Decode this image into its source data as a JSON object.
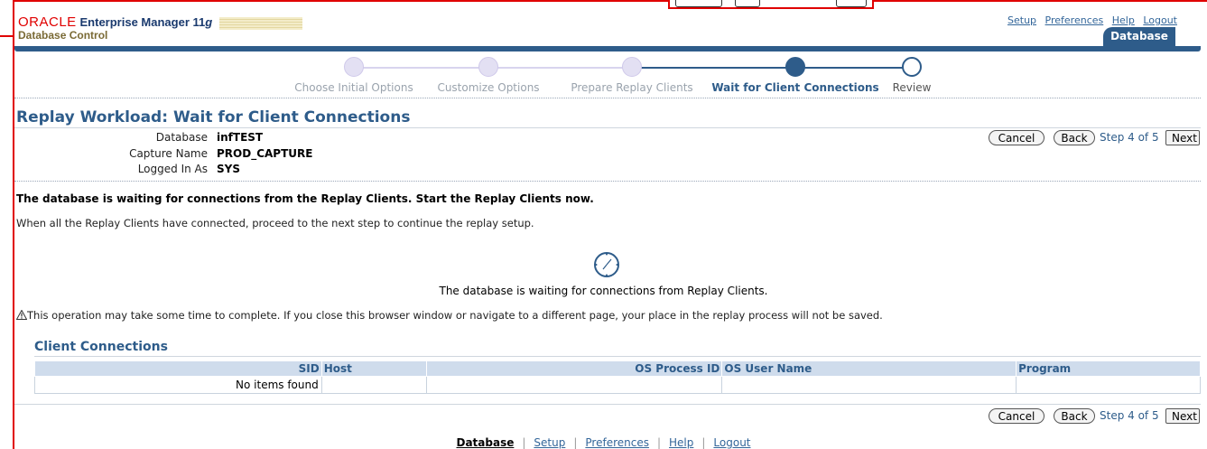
{
  "header": {
    "oracle": "ORACLE",
    "product": "Enterprise Manager 11",
    "version_suffix": "g",
    "subtitle": "Database Control",
    "links": [
      "Setup",
      "Preferences",
      "Help",
      "Logout"
    ],
    "tab": "Database"
  },
  "train": {
    "steps": [
      "Choose Initial Options",
      "Customize Options",
      "Prepare Replay Clients",
      "Wait for Client Connections",
      "Review"
    ],
    "current_step_index": 3,
    "colors": {
      "done": "#e3e0f3",
      "current": "#2e5c8a",
      "future": "#ffffff",
      "line_done": "#d8d4ee",
      "line_current": "#2e5c8a"
    }
  },
  "page": {
    "title": "Replay Workload: Wait for Client Connections",
    "info": [
      {
        "label": "Database",
        "value": "infTEST"
      },
      {
        "label": "Capture Name",
        "value": "PROD_CAPTURE"
      },
      {
        "label": "Logged In As",
        "value": "SYS"
      }
    ],
    "buttons": {
      "cancel": "Cancel",
      "back": "Back",
      "step": "Step 4 of 5",
      "next": "Next"
    },
    "message_bold": "The database is waiting for connections from the Replay Clients. Start the Replay Clients now.",
    "message": "When all the Replay Clients have connected, proceed to the next step to continue the replay setup.",
    "waiting_text": "The database is waiting for connections from Replay Clients.",
    "warning": "This operation may take some time to complete. If you close this browser window or navigate to a different page, your place in the replay process will not be saved."
  },
  "client_connections": {
    "title": "Client Connections",
    "columns": [
      "SID",
      "Host",
      "OS Process ID",
      "OS User Name",
      "Program"
    ],
    "empty_text": "No items found"
  },
  "footer": {
    "links": [
      "Database",
      "Setup",
      "Preferences",
      "Help",
      "Logout"
    ]
  },
  "colors": {
    "accent": "#2e5c8a",
    "brand_red": "#e00000",
    "link": "#33669a"
  }
}
